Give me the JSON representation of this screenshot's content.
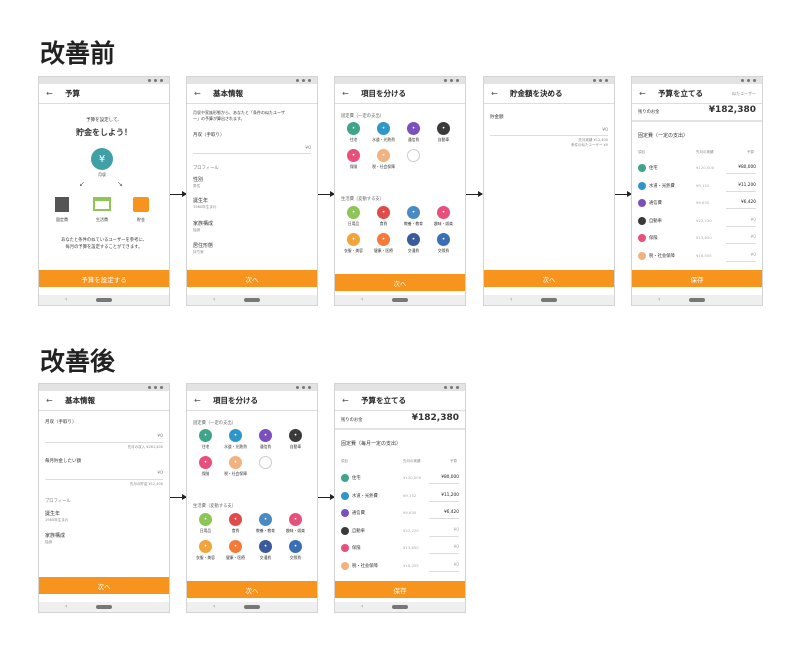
{
  "before": {
    "label": "改善前"
  },
  "after": {
    "label": "改善後"
  },
  "s1": {
    "title": "予算",
    "intro1": "予算を設定して、",
    "intro2": "貯金をしよう！",
    "center": "月収",
    "c1": "固定費",
    "c2": "生活費",
    "c3": "貯金",
    "desc1": "あなたと条件の似ているユーザーを参考に、",
    "desc2": "毎月の予算を設定することができます。",
    "cta": "予算を設定する"
  },
  "s2": {
    "title": "基本情報",
    "desc1": "月収や家族形態から、あなたと「条件の似たユーザ",
    "desc2": "ー」の予算が算出されます。",
    "income": "月収（手取り）",
    "yen": "¥0",
    "profile": "プロフィール",
    "f1": "性別",
    "v1": "男性",
    "f2": "誕生年",
    "v2": "1980年生まれ",
    "f3": "家族構成",
    "v3": "独身",
    "f4": "居住形態",
    "v4": "持ち家",
    "cta": "次へ"
  },
  "s3": {
    "title": "項目を分ける",
    "fixed": "固定費（一定の支出）",
    "variable": "生活費（変動する支）",
    "fixedItems": [
      "住宅",
      "水道・光熱費",
      "通信費",
      "自動車",
      "保険",
      "税・社会保障"
    ],
    "varItems": [
      "日用品",
      "食費",
      "教養・教育",
      "趣味・娯楽",
      "衣服・美容",
      "健康・医療",
      "交通費",
      "交際費"
    ],
    "cta": "次へ"
  },
  "s4": {
    "title": "貯金額を決める",
    "label": "貯金額",
    "yen": "¥0",
    "hint1": "先月実績 ¥12,400",
    "hint2": "条件の似たユーザー ¥0",
    "cta": "次へ"
  },
  "s5": {
    "title": "予算を立てる",
    "topRight": "似たユーザー",
    "remainLabel": "残りのお金",
    "amount": "¥182,380",
    "fixedHeader": "固定費（一定の支出）",
    "colName": "項目",
    "colPrev": "先月の実績",
    "colBudget": "予算",
    "rows": [
      {
        "name": "住宅",
        "prev": "¥120,000",
        "val": "¥80,000"
      },
      {
        "name": "水道・光熱費",
        "prev": "¥9,152",
        "val": "¥11,200"
      },
      {
        "name": "通信費",
        "prev": "¥9,630",
        "val": "¥6,420"
      },
      {
        "name": "自動車",
        "prev": "¥22,720",
        "val": "¥0"
      },
      {
        "name": "保険",
        "prev": "¥13,650",
        "val": "¥0"
      },
      {
        "name": "税・社会保障",
        "prev": "¥18,055",
        "val": "¥0"
      }
    ],
    "cta": "保存"
  },
  "a1": {
    "title": "基本情報",
    "income": "月収（手取り）",
    "yen1": "¥0",
    "hint1": "先月の収入 ¥281,400",
    "savings": "毎月貯金したい額",
    "yen2": "¥0",
    "hint2": "先月の貯金 ¥12,400",
    "profile": "プロフィール",
    "f1": "誕生年",
    "v1": "1980年生まれ",
    "f2": "家族構成",
    "v2": "独身",
    "cta": "次へ"
  },
  "a2": {
    "title": "項目を分ける",
    "fixed": "固定費（一定の支出）",
    "variable": "生活費（変動する支）",
    "fixedItems": [
      "住宅",
      "水道・光熱費",
      "通信費",
      "自動車",
      "保険",
      "税・社会保障"
    ],
    "varItems": [
      "日用品",
      "食費",
      "教養・教育",
      "趣味・娯楽",
      "衣服・美容",
      "健康・医療",
      "交通費",
      "交際費"
    ],
    "cta": "次へ"
  },
  "a3": {
    "title": "予算を立てる",
    "remainLabel": "残りのお金",
    "amount": "¥182,380",
    "fixedHeader": "固定費（毎月一定の支出）",
    "colName": "項目",
    "colPrev": "先月の実績",
    "colBudget": "予算",
    "rows": [
      {
        "name": "住宅",
        "prev": "¥120,000",
        "val": "¥80,000"
      },
      {
        "name": "水道・光熱費",
        "prev": "¥9,152",
        "val": "¥11,200"
      },
      {
        "name": "通信費",
        "prev": "¥9,630",
        "val": "¥6,420"
      },
      {
        "name": "自動車",
        "prev": "¥22,720",
        "val": "¥0"
      },
      {
        "name": "保険",
        "prev": "¥13,650",
        "val": "¥0"
      },
      {
        "name": "税・社会保障",
        "prev": "¥18,055",
        "val": "¥0"
      }
    ],
    "cta": "保存"
  },
  "colors": {
    "accent": "#f7941d",
    "fixedColors": [
      "#3fa58a",
      "#2f96c9",
      "#7b4fbd",
      "#3a3a3a",
      "#e84f7b",
      "#f1b27f"
    ],
    "varColors": [
      "#8ec557",
      "#e24a4a",
      "#4a8ac4",
      "#e84f7b",
      "#f2a33a",
      "#f47a3a",
      "#3a5a9c",
      "#3a6fb5"
    ]
  }
}
